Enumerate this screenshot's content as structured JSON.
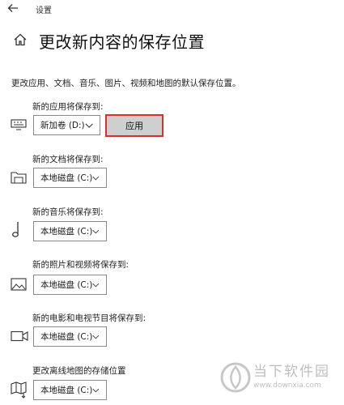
{
  "window": {
    "title": "设置"
  },
  "header": {
    "title": "更改新内容的保存位置"
  },
  "description": "更改应用、文档、音乐、图片、视频和地图的默认保存位置。",
  "sections": [
    {
      "label": "新的应用将保存到:",
      "value": "新加卷 (D:)",
      "icon": "monitor-icon",
      "apply_label": "应用"
    },
    {
      "label": "新的文档将保存到:",
      "value": "本地磁盘 (C:)",
      "icon": "folder-icon"
    },
    {
      "label": "新的音乐将保存到:",
      "value": "本地磁盘 (C:)",
      "icon": "music-note-icon"
    },
    {
      "label": "新的照片和视频将保存到:",
      "value": "本地磁盘 (C:)",
      "icon": "image-icon"
    },
    {
      "label": "新的电影和电视节目将保存到:",
      "value": "本地磁盘 (C:)",
      "icon": "video-camera-icon"
    },
    {
      "label": "更改离线地图的存储位置",
      "value": "本地磁盘 (C:)",
      "icon": "map-icon"
    }
  ],
  "watermark": {
    "line1": "当下软件园",
    "line2": "www.downxia.com"
  },
  "colors": {
    "apply_border": "#d9302b",
    "apply_bg": "#cfcfcf",
    "dropdown_border": "#8a8a8a"
  }
}
